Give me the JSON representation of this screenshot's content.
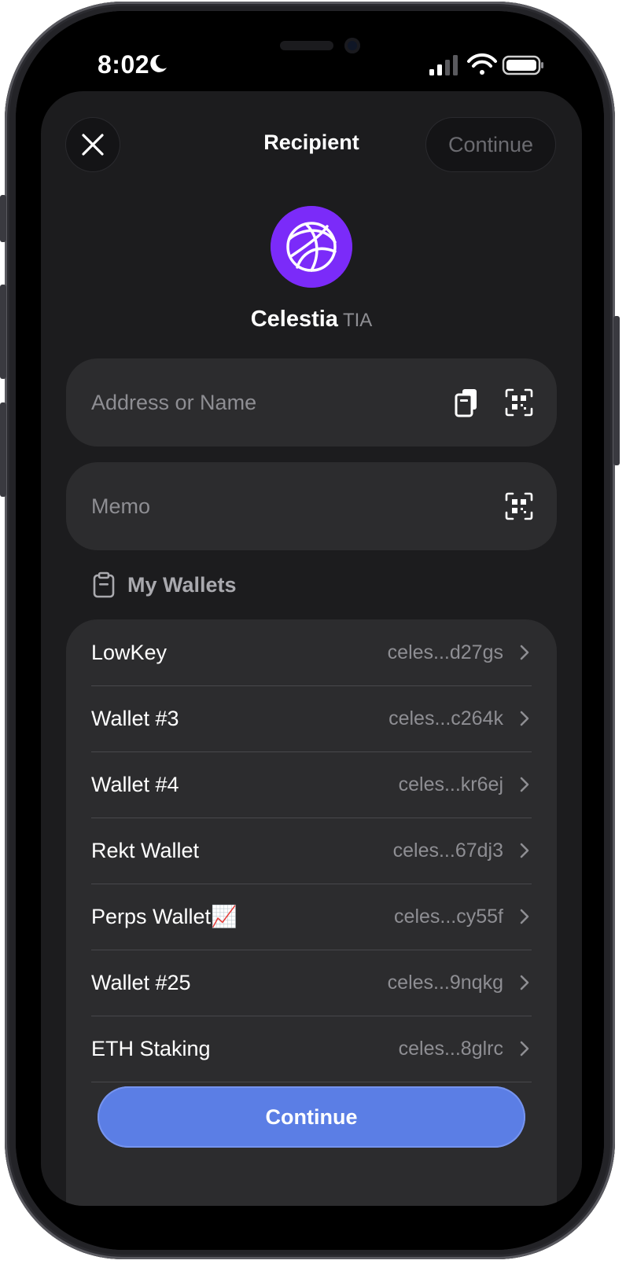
{
  "status_bar": {
    "time": "8:02",
    "icons": [
      "moon-icon",
      "cellular-signal-icon",
      "wifi-icon",
      "battery-icon"
    ]
  },
  "header": {
    "title": "Recipient",
    "continue_label": "Continue",
    "close_icon": "close-icon"
  },
  "token": {
    "name": "Celestia",
    "symbol": "TIA",
    "logo_color": "#7B2BF9",
    "icon": "celestia-logo"
  },
  "address_field": {
    "placeholder": "Address or Name",
    "icons": [
      "paste-icon",
      "qr-scan-icon"
    ]
  },
  "memo_field": {
    "placeholder": "Memo",
    "icons": [
      "qr-scan-icon"
    ]
  },
  "wallets": {
    "section_label": "My Wallets",
    "section_icon": "clipboard-icon",
    "items": [
      {
        "name": "LowKey",
        "address": "celes...d27gs"
      },
      {
        "name": "Wallet #3",
        "address": "celes...c264k"
      },
      {
        "name": "Wallet #4",
        "address": "celes...kr6ej"
      },
      {
        "name": "Rekt Wallet",
        "address": "celes...67dj3"
      },
      {
        "name": "Perps Wallet📈",
        "address": "celes...cy55f"
      },
      {
        "name": "Wallet #25",
        "address": "celes...9nqkg"
      },
      {
        "name": "ETH Staking",
        "address": "celes...8glrc"
      }
    ]
  },
  "footer": {
    "continue_label": "Continue",
    "accent_color": "#5B7EE5"
  }
}
